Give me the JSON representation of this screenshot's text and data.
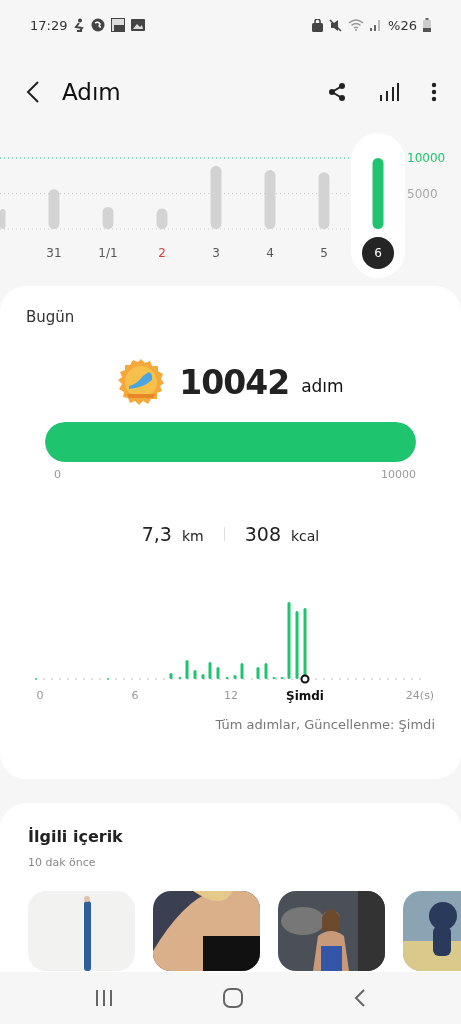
{
  "status_bar": {
    "time": "17:29",
    "battery": "%26"
  },
  "app_bar": {
    "title": "Adım"
  },
  "weekly": {
    "chart_data": {
      "type": "bar",
      "categories": [
        "31",
        "1/1",
        "2",
        "3",
        "4",
        "5",
        "6"
      ],
      "series": [
        {
          "color": "#d3d3d3",
          "values": [
            5600,
            3100,
            2900,
            8900,
            8300,
            8000,
            null
          ]
        },
        {
          "color": "#1ec46e",
          "values": [
            null,
            null,
            null,
            null,
            null,
            null,
            10000
          ]
        }
      ],
      "ylim": [
        0,
        10000
      ],
      "yticks": [
        {
          "value": 5000,
          "label": "5000"
        },
        {
          "value": 10000,
          "label": "10000"
        }
      ]
    },
    "days": [
      {
        "selected": false,
        "holiday": false
      },
      {
        "selected": false,
        "holiday": false
      },
      {
        "selected": false,
        "holiday": true
      },
      {
        "selected": false,
        "holiday": false
      },
      {
        "selected": false,
        "holiday": false
      },
      {
        "selected": false,
        "holiday": false
      },
      {
        "selected": true,
        "holiday": false
      }
    ]
  },
  "today": {
    "title": "Bugün",
    "steps": "10042",
    "steps_unit": "adım",
    "goal": {
      "level": 1,
      "min": "0",
      "max": "10000"
    },
    "distance": "7,3",
    "distance_unit": "km",
    "calories": "308",
    "calories_unit": "kcal",
    "hourly": {
      "axis_labels": [
        {
          "label": "0",
          "current": false
        },
        {
          "label": "6",
          "current": false
        },
        {
          "label": "12",
          "current": false
        },
        {
          "label": "Şimdi",
          "current": true
        },
        {
          "label": "24(s)",
          "current": false
        }
      ]
    },
    "footnote": "Tüm adımlar, Güncellenme: Şimdi"
  },
  "related": {
    "title": "İlgili içerik",
    "subtitle": "10 dak önce"
  }
}
